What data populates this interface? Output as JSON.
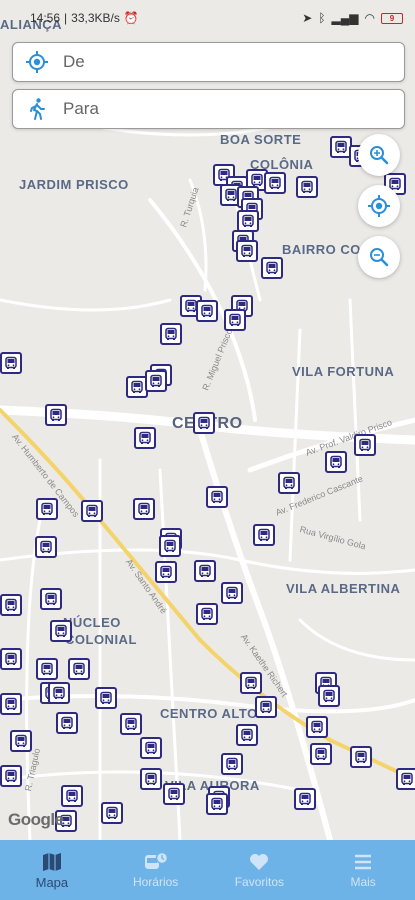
{
  "status_bar": {
    "time": "14:56",
    "network_speed": "33,3KB/s",
    "battery_level": "9"
  },
  "search": {
    "from_placeholder": "De",
    "to_placeholder": "Para"
  },
  "map": {
    "districts": [
      {
        "name": "BOA SORTE"
      },
      {
        "name": "COLÔNIA"
      },
      {
        "name": "JARDIM PRISCO"
      },
      {
        "name": "BAIRRO COL"
      },
      {
        "name": "VILA FORTUNA"
      },
      {
        "name": "CENTRO"
      },
      {
        "name": "VILA ALBERTINA"
      },
      {
        "name": "NÚCLEO"
      },
      {
        "name": "COLONIAL"
      },
      {
        "name": "CENTRO ALTO"
      },
      {
        "name": "VILA AURORA"
      },
      {
        "name": "ALIANÇA"
      }
    ],
    "streets": [
      "Av. Humberto de Campos",
      "Av. Santo André",
      "Av. Kaethe Richert",
      "Av. Prof. Valdiro Prisco",
      "Av. Frederico Cascante",
      "Rua Virgílio Gola",
      "R. Miguel Prisco",
      "R. Turquia",
      "R. Triagulo"
    ],
    "attribution": "Google"
  },
  "nav": {
    "items": [
      {
        "label": "Mapa",
        "icon": "map-icon"
      },
      {
        "label": "Horários",
        "icon": "bus-schedule-icon"
      },
      {
        "label": "Favoritos",
        "icon": "heart-icon"
      },
      {
        "label": "Mais",
        "icon": "menu-icon"
      }
    ]
  },
  "colors": {
    "accent": "#2d2a80",
    "nav_bg": "#6eb3e8",
    "fab_icon": "#2b8fd8"
  }
}
